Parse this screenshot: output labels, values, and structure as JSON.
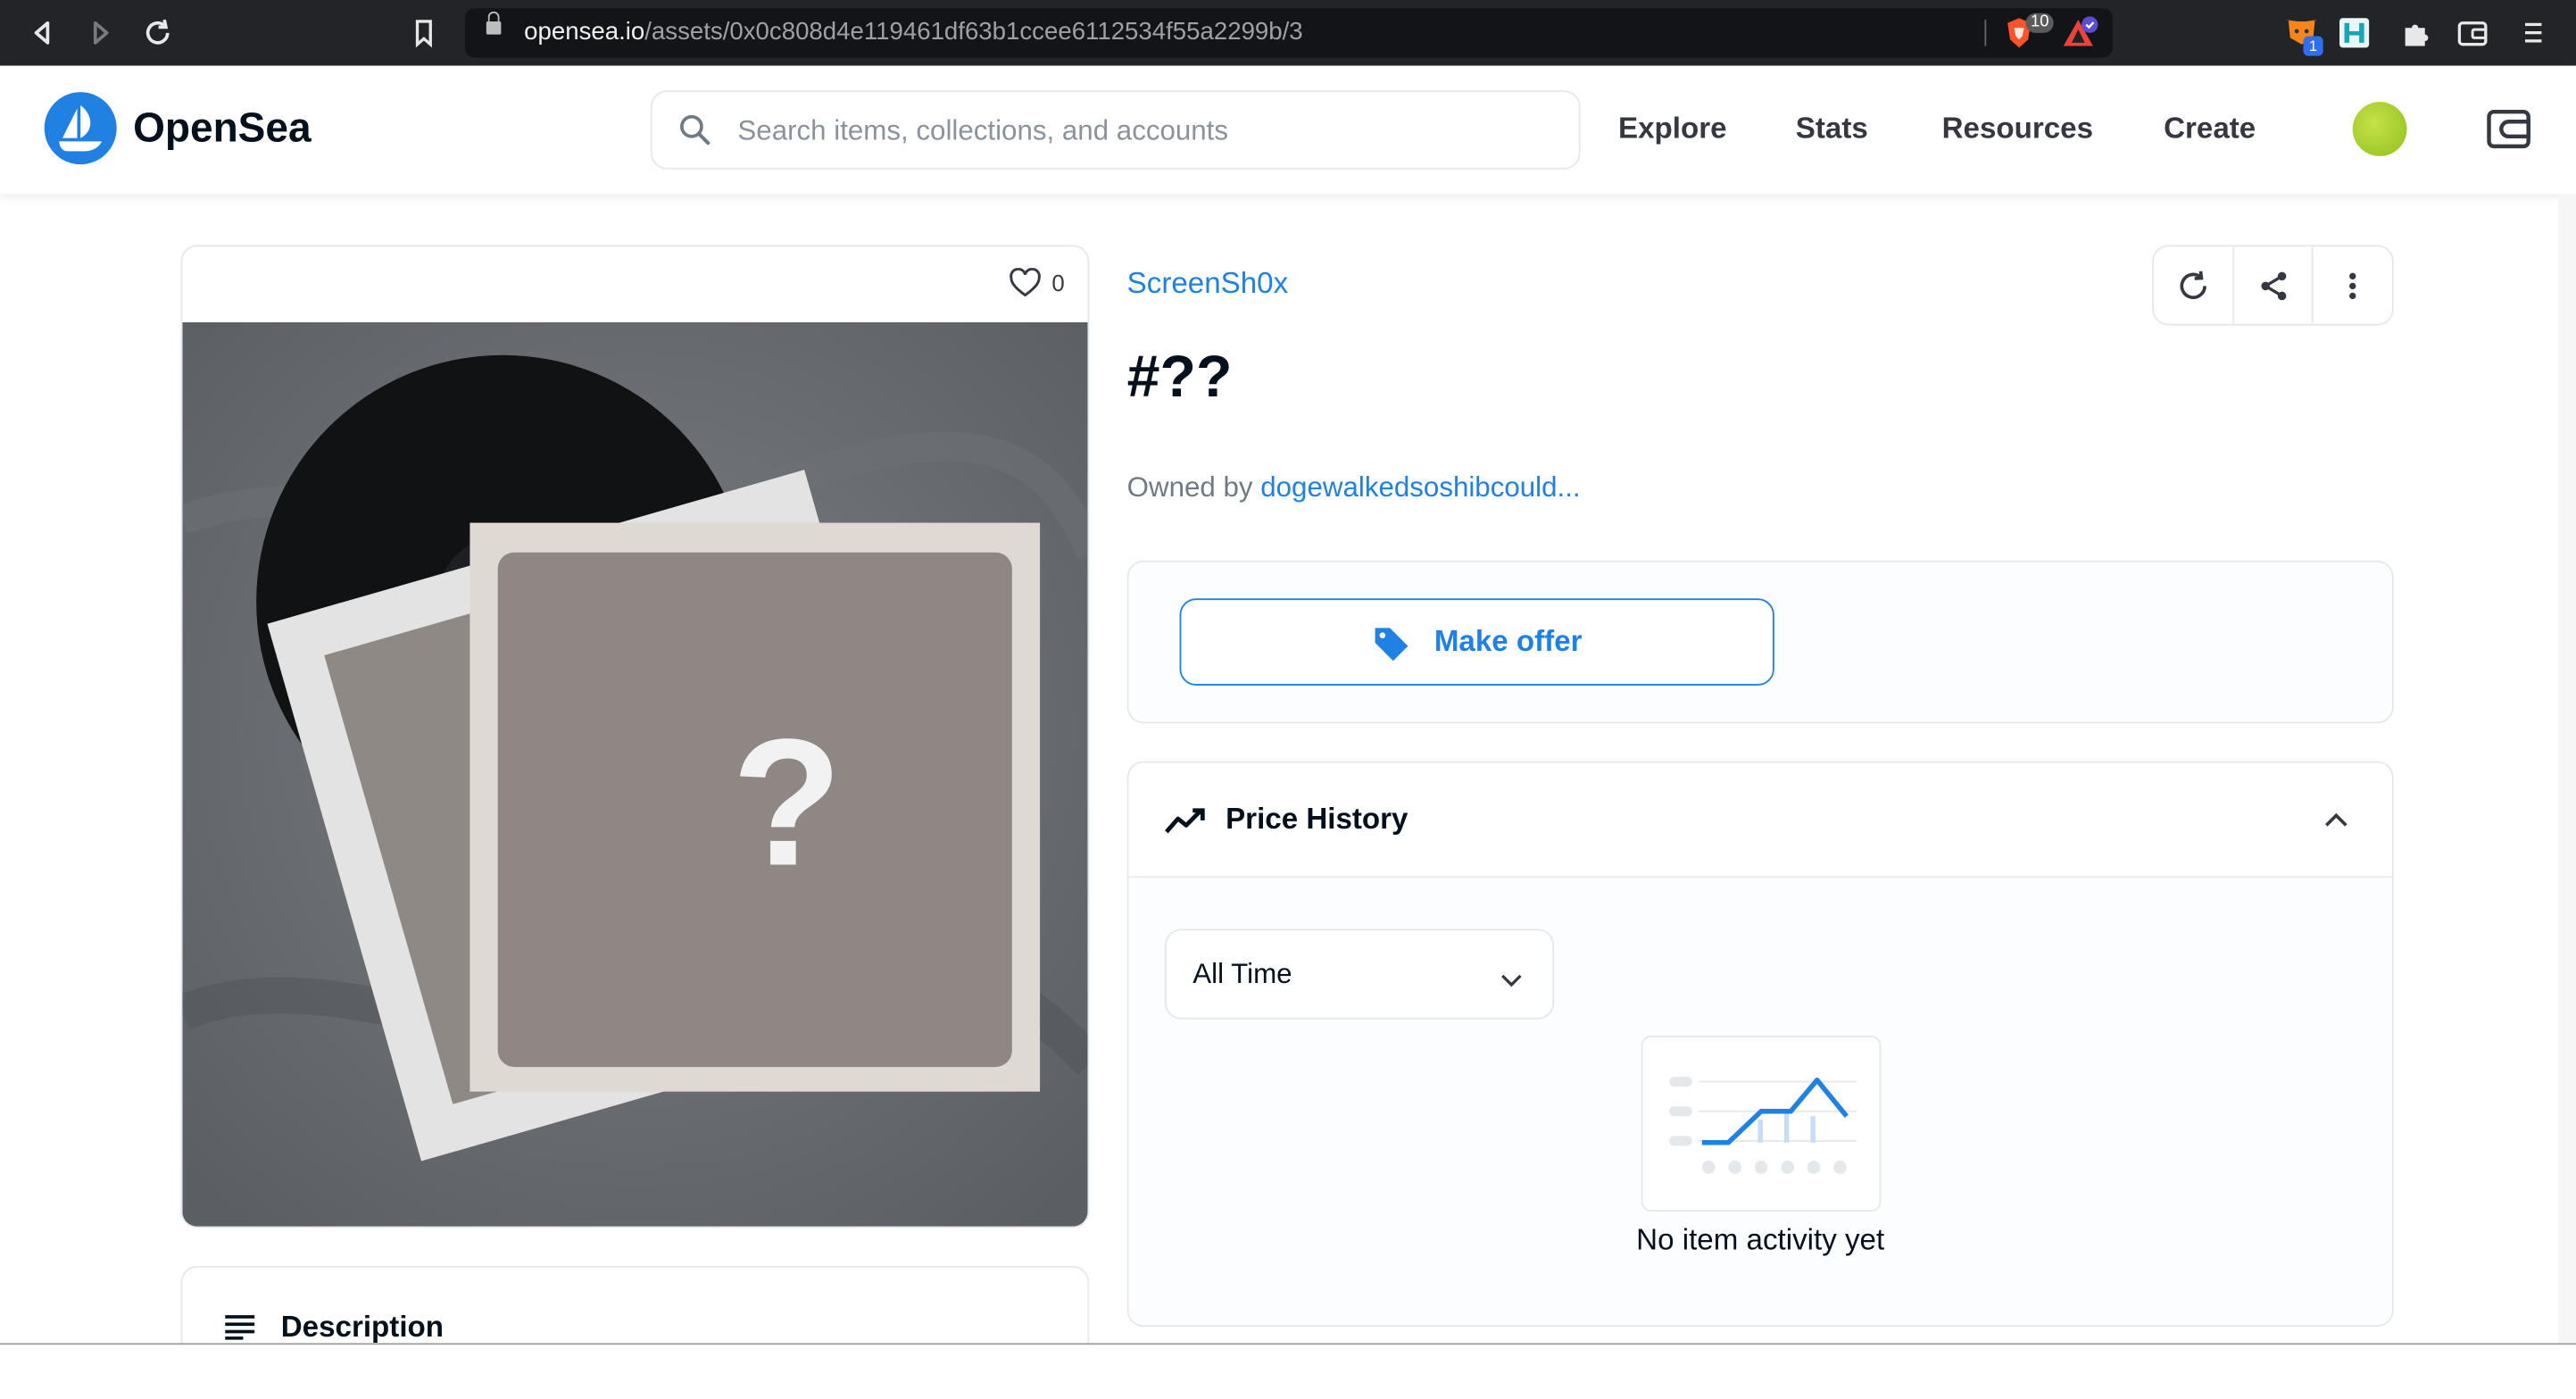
{
  "browser": {
    "url_host": "opensea.io",
    "url_path": "/assets/0x0c808d4e119461df63b1ccee6112534f55a2299b/3",
    "brave_badge": "10",
    "metamask_badge": "1"
  },
  "header": {
    "brand": "OpenSea",
    "search_placeholder": "Search items, collections, and accounts",
    "nav": [
      "Explore",
      "Stats",
      "Resources",
      "Create"
    ]
  },
  "item": {
    "favorites": "0",
    "collection": "ScreenSh0x",
    "title": "#??",
    "owned_by_label": "Owned by",
    "owner": "dogewalkedsoshibcould..."
  },
  "offer": {
    "button_label": "Make offer"
  },
  "price_history": {
    "title": "Price History",
    "range_selected": "All Time",
    "empty_text": "No item activity yet"
  },
  "description": {
    "title": "Description"
  },
  "colors": {
    "accent": "#2081e2",
    "text": "#04111d",
    "muted": "#707a83",
    "border": "#e5e8eb"
  }
}
